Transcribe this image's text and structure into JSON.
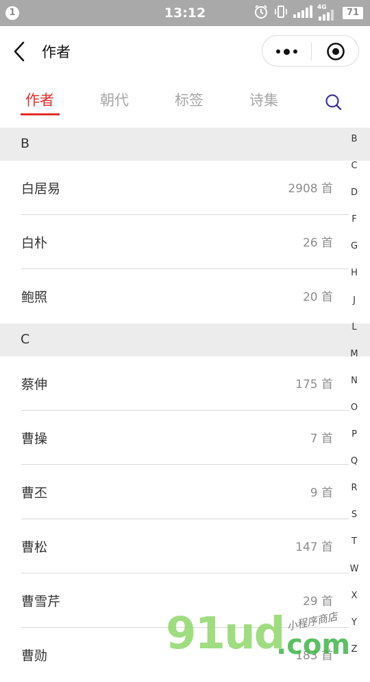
{
  "status_bar": {
    "notification_count": "1",
    "time": "13:12",
    "network": "4G",
    "battery": "71"
  },
  "nav": {
    "title": "作者"
  },
  "tabs": [
    {
      "label": "作者",
      "active": true
    },
    {
      "label": "朝代",
      "active": false
    },
    {
      "label": "标签",
      "active": false
    },
    {
      "label": "诗集",
      "active": false
    }
  ],
  "sections": [
    {
      "letter": "B",
      "items": [
        {
          "name": "白居易",
          "count": "2908 首"
        },
        {
          "name": "白朴",
          "count": "26 首"
        },
        {
          "name": "鲍照",
          "count": "20 首"
        }
      ]
    },
    {
      "letter": "C",
      "items": [
        {
          "name": "蔡伸",
          "count": "175 首"
        },
        {
          "name": "曹操",
          "count": "7 首"
        },
        {
          "name": "曹丕",
          "count": "9 首"
        },
        {
          "name": "曹松",
          "count": "147 首"
        },
        {
          "name": "曹雪芹",
          "count": "29 首"
        },
        {
          "name": "曹勋",
          "count": "183 首"
        }
      ]
    }
  ],
  "index_letters": [
    "B",
    "C",
    "D",
    "F",
    "G",
    "H",
    "J",
    "L",
    "M",
    "N",
    "O",
    "P",
    "Q",
    "R",
    "S",
    "T",
    "W",
    "X",
    "Y",
    "Z"
  ],
  "watermark": {
    "logo": "91ud",
    "suffix": ".com",
    "tagline": "小程序商店"
  },
  "colors": {
    "accent": "#e62a2a",
    "search_icon": "#3b2fa0",
    "status_bar_bg": "#a9a9a9",
    "section_header_bg": "#ececec"
  }
}
